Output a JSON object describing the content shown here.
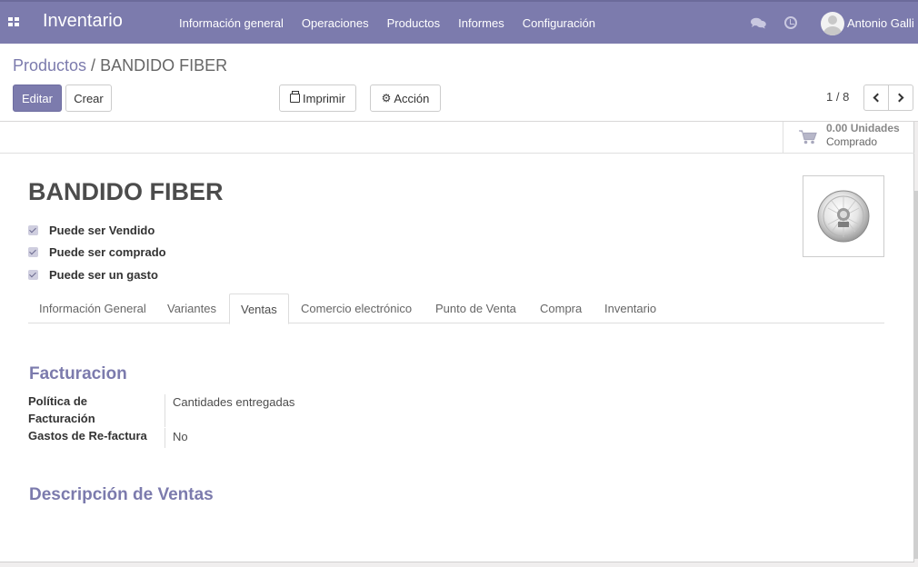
{
  "app": {
    "title": "Inventario",
    "menu": [
      "Información general",
      "Operaciones",
      "Productos",
      "Informes",
      "Configuración"
    ],
    "user": "Antonio Galli"
  },
  "breadcrumb": {
    "parent": "Productos",
    "separator": " / ",
    "current": "BANDIDO FIBER"
  },
  "toolbar": {
    "edit": "Editar",
    "create": "Crear",
    "print": "Imprimir",
    "action": "Acción",
    "pager": "1 / 8"
  },
  "stat": {
    "value": "0.00 Unidades",
    "label": "Comprado",
    "icon": "shopping-cart-icon"
  },
  "product": {
    "name": "BANDIDO FIBER",
    "options": [
      {
        "label": "Puede ser Vendido",
        "checked": true
      },
      {
        "label": "Puede ser comprado",
        "checked": true
      },
      {
        "label": "Puede ser un gasto",
        "checked": true
      }
    ]
  },
  "tabs": [
    "Información General",
    "Variantes",
    "Ventas",
    "Comercio electrónico",
    "Punto de Venta",
    "Compra",
    "Inventario"
  ],
  "active_tab": "Ventas",
  "sales": {
    "invoicing_title": "Facturacion",
    "fields": [
      {
        "label": "Política de Facturación",
        "value": "Cantidades entregadas"
      },
      {
        "label": "Gastos de Re-factura",
        "value": "No"
      }
    ],
    "description_title": "Descripción de Ventas"
  },
  "colors": {
    "brand": "#7c7bad",
    "background": "#f0eeee"
  }
}
